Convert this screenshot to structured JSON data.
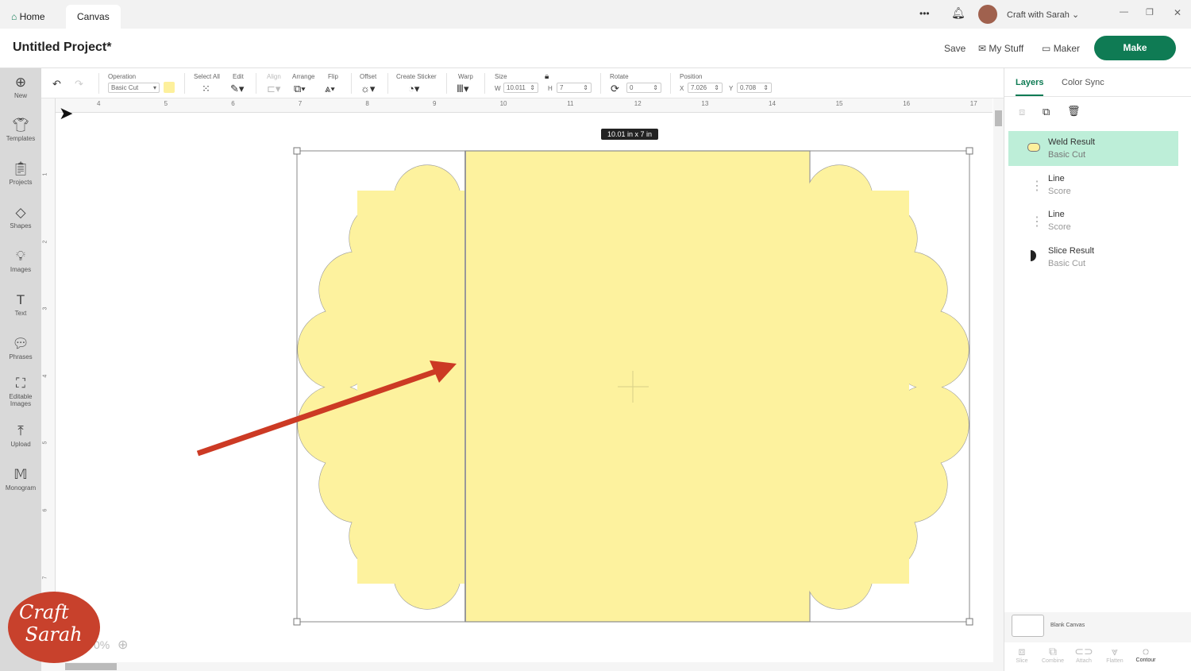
{
  "titlebar": {
    "home": "Home",
    "canvas": "Canvas",
    "more": "•••",
    "user": "Craft with Sarah"
  },
  "header": {
    "project_title": "Untitled Project*",
    "save": "Save",
    "my_stuff": "My Stuff",
    "maker": "Maker",
    "make": "Make"
  },
  "sidebar": [
    {
      "icon": "plus-circle-icon",
      "label": "New"
    },
    {
      "icon": "shirt-icon",
      "label": "Templates"
    },
    {
      "icon": "clipboard-icon",
      "label": "Projects"
    },
    {
      "icon": "shapes-icon",
      "label": "Shapes"
    },
    {
      "icon": "lightbulb-icon",
      "label": "Images"
    },
    {
      "icon": "text-icon",
      "label": "Text"
    },
    {
      "icon": "speech-icon",
      "label": "Phrases"
    },
    {
      "icon": "editable-image-icon",
      "label": "Editable Images"
    },
    {
      "icon": "upload-icon",
      "label": "Upload"
    },
    {
      "icon": "monogram-icon",
      "label": "Monogram"
    }
  ],
  "toolbar": {
    "operation_label": "Operation",
    "operation_value": "Basic Cut",
    "select_all": "Select All",
    "edit": "Edit",
    "align": "Align",
    "arrange": "Arrange",
    "flip": "Flip",
    "offset": "Offset",
    "create_sticker": "Create Sticker",
    "warp": "Warp",
    "size": "Size",
    "w_label": "W",
    "w": "10.011",
    "h_label": "H",
    "h": "7",
    "rotate": "Rotate",
    "rotate_value": "0",
    "position": "Position",
    "x_label": "X",
    "x": "7.026",
    "y_label": "Y",
    "y": "0.708",
    "layer_color": "#fdf09c"
  },
  "ruler": {
    "h": [
      "4",
      "5",
      "6",
      "7",
      "8",
      "9",
      "10",
      "11",
      "12",
      "13",
      "14",
      "15",
      "16",
      "17"
    ],
    "v": [
      "1",
      "2",
      "3",
      "4",
      "5",
      "6",
      "7"
    ]
  },
  "canvas": {
    "size_tooltip": "10.01  in x 7  in",
    "zoom": "0%",
    "shape_fill": "#fdf29e",
    "arrow_color": "#cc3a24"
  },
  "panel": {
    "tabs": [
      "Layers",
      "Color Sync"
    ],
    "layers": [
      {
        "name": "Weld Result",
        "sub": "Basic Cut"
      },
      {
        "name": "Line",
        "sub": "Score"
      },
      {
        "name": "Line",
        "sub": "Score"
      },
      {
        "name": "Slice Result",
        "sub": "Basic Cut"
      }
    ],
    "blank_canvas": "Blank Canvas",
    "bottom": [
      "Slice",
      "Combine",
      "Attach",
      "Flatten",
      "Contour"
    ]
  },
  "logo": {
    "text": "Craft with Sarah"
  }
}
